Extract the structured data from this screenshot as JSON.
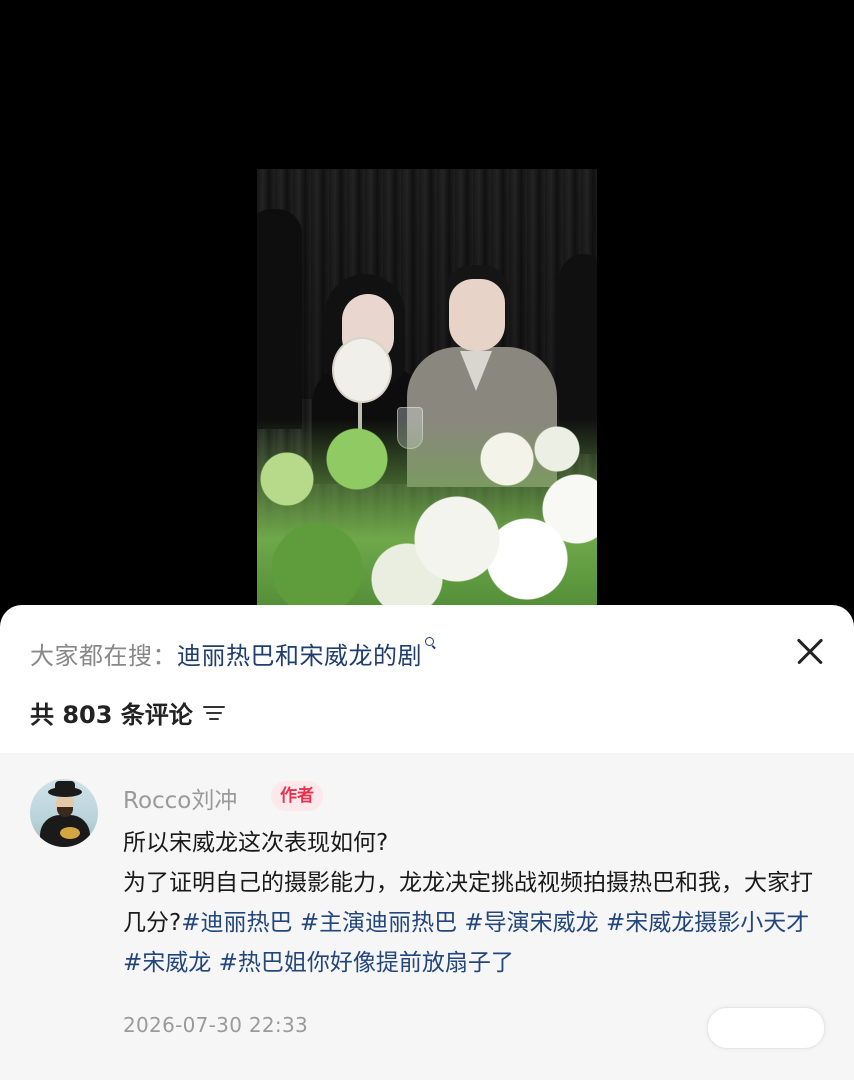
{
  "sheet": {
    "search_label": "大家都在搜：",
    "search_query": "迪丽热巴和宋威龙的剧",
    "comment_count": "共 803 条评论"
  },
  "comment": {
    "author": "Rocco刘冲",
    "badge": "作者",
    "line1": "所以宋威龙这次表现如何?",
    "line2": "为了证明自己的摄影能力，龙龙决定挑战视频拍摄热巴和我，大家打几分?",
    "tags": [
      "#迪丽热巴",
      "#主演迪丽热巴",
      "#导演宋威龙",
      "#宋威龙摄影小天才",
      "#宋威龙",
      "#热巴姐你好像提前放扇子了"
    ],
    "timestamp": "2026-07-30 22:33"
  },
  "icons": {
    "close": "close-icon",
    "sort": "sort-icon",
    "search": "search-icon"
  },
  "colors": {
    "hashtag": "#23467d",
    "badge_text": "#e6344f",
    "badge_bg": "#fde8ec"
  }
}
